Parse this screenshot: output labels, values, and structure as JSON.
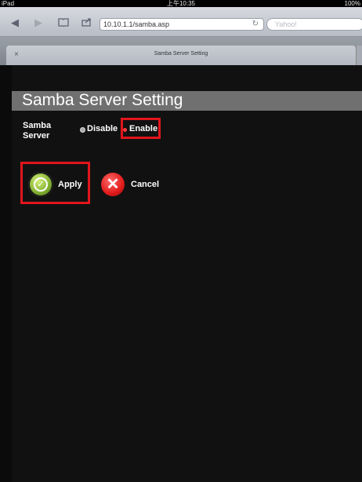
{
  "status": {
    "device": "iPad",
    "time": "上午10:35",
    "battery": "100%"
  },
  "browser": {
    "url": "10.10.1.1/samba.asp",
    "search_placeholder": "Yahoo!",
    "tab_title": "Samba Server Setting",
    "tab_close": "×"
  },
  "icons": {
    "back": "◀",
    "forward": "▶",
    "bookmarks": "📖",
    "share": "⇪",
    "reload": "↻",
    "check": "✓",
    "cancel": "✕",
    "wifi": "wifi"
  },
  "page": {
    "title": "Samba Server Setting",
    "samba_label_line1": "Samba",
    "samba_label_line2": "Server",
    "option_disable": "Disable",
    "option_enable": "Enable",
    "selected_option": "Enable",
    "apply_label": "Apply",
    "cancel_label": "Cancel"
  },
  "colors": {
    "highlight": "#e2151c",
    "title_bar": "#707070",
    "apply_icon": "#7fae2f",
    "cancel_icon": "#e21b1b"
  }
}
